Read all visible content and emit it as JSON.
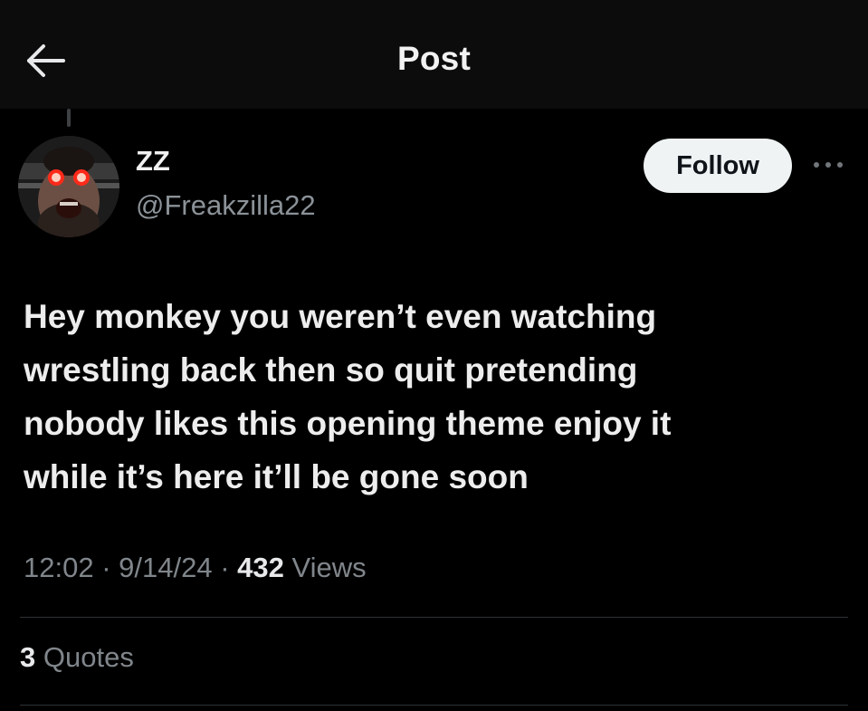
{
  "header": {
    "title": "Post",
    "back_icon": "arrow-left-icon"
  },
  "post": {
    "author": {
      "display_name": "ZZ",
      "handle": "@Freakzilla22",
      "avatar_icon": "avatar-photo"
    },
    "follow_label": "Follow",
    "more_icon": "more-dots-icon",
    "text": "Hey monkey you weren’t even watching\nwrestling back then so quit pretending\nnobody likes this opening theme enjoy it\nwhile it’s here it’ll be gone soon",
    "time": "12:02",
    "date": "9/14/24",
    "separator": "·",
    "views_count": "432",
    "views_label": "Views",
    "quotes_count": "3",
    "quotes_label": "Quotes"
  },
  "colors": {
    "background": "#000000",
    "header_background": "#0c0c0c",
    "text_primary": "#e7e9ea",
    "text_secondary": "#80868b",
    "follow_button": "#eff3f4",
    "avatar_eyes": "#ff2a1a"
  }
}
